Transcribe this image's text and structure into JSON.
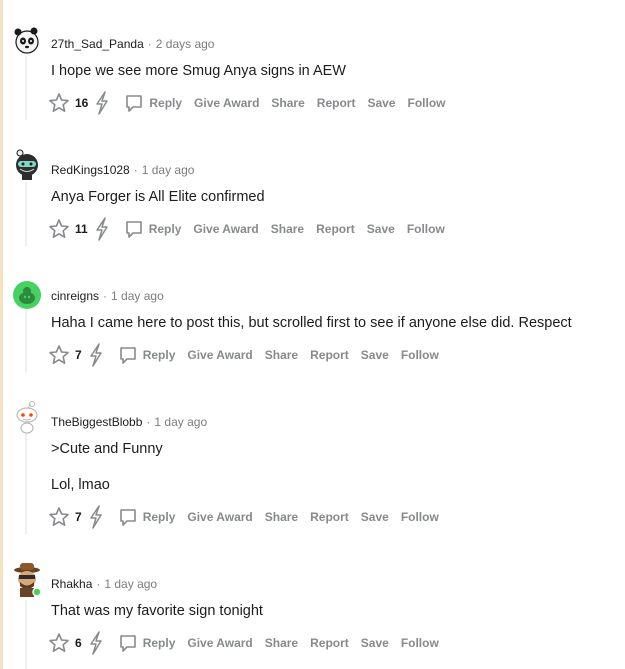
{
  "colors": {
    "accent_line": "#f6e3c0",
    "thread_line": "#edeff1",
    "meta_gray": "#7c7c7c",
    "action_gray": "#878a8c",
    "text": "#1c1c1c"
  },
  "comments": [
    {
      "username": "27th_Sad_Panda",
      "separator": "·",
      "time": "2 days ago",
      "body": [
        "I hope we see more Smug Anya signs in AEW"
      ],
      "score": "16",
      "avatar": "panda-avatar-icon",
      "actions": {
        "reply": "Reply",
        "award": "Give Award",
        "share": "Share",
        "report": "Report",
        "save": "Save",
        "follow": "Follow"
      }
    },
    {
      "username": "RedKings1028",
      "separator": "·",
      "time": "1 day ago",
      "body": [
        "Anya Forger is All Elite confirmed"
      ],
      "score": "11",
      "avatar": "masked-avatar-icon",
      "actions": {
        "reply": "Reply",
        "award": "Give Award",
        "share": "Share",
        "report": "Report",
        "save": "Save",
        "follow": "Follow"
      }
    },
    {
      "username": "cinreigns",
      "separator": "·",
      "time": "1 day ago",
      "body": [
        "Haha I came here to post this, but scrolled first to see if anyone else did. Respect"
      ],
      "score": "7",
      "avatar": "default-green-avatar-icon",
      "actions": {
        "reply": "Reply",
        "award": "Give Award",
        "share": "Share",
        "report": "Report",
        "save": "Save",
        "follow": "Follow"
      }
    },
    {
      "username": "TheBiggestBlobb",
      "separator": "·",
      "time": "1 day ago",
      "body": [
        ">Cute and Funny",
        "Lol, lmao"
      ],
      "score": "7",
      "avatar": "snoo-avatar-icon",
      "actions": {
        "reply": "Reply",
        "award": "Give Award",
        "share": "Share",
        "report": "Report",
        "save": "Save",
        "follow": "Follow"
      }
    },
    {
      "username": "Rhakha",
      "separator": "·",
      "time": "1 day ago",
      "body": [
        "That was my favorite sign tonight"
      ],
      "score": "6",
      "avatar": "cowboy-avatar-icon",
      "actions": {
        "reply": "Reply",
        "award": "Give Award",
        "share": "Share",
        "report": "Report",
        "save": "Save",
        "follow": "Follow"
      }
    }
  ]
}
